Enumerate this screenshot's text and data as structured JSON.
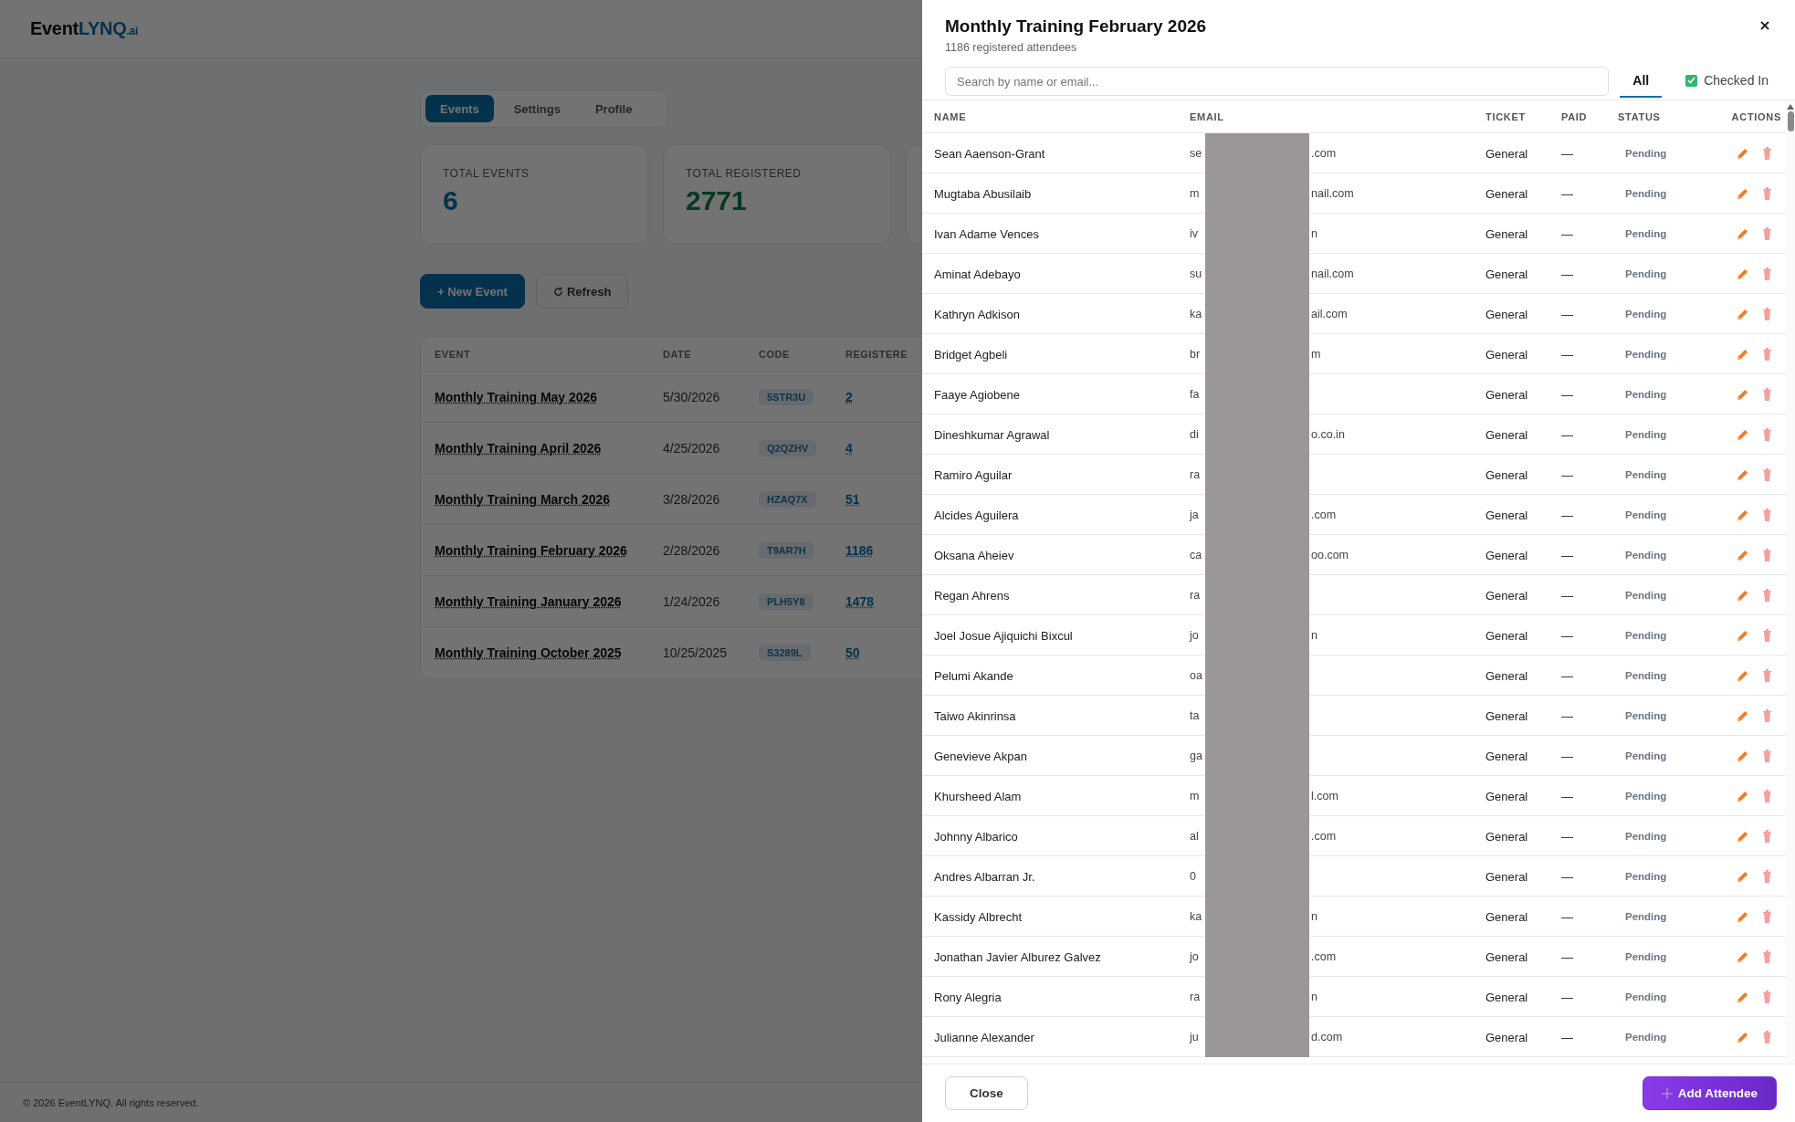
{
  "app": {
    "logo": {
      "main": "Event",
      "accent": "LYNQ",
      "suffix": ".ai"
    },
    "tabs": [
      {
        "label": "Events",
        "selected": true
      },
      {
        "label": "Settings",
        "selected": false
      },
      {
        "label": "Profile",
        "selected": false
      }
    ],
    "stats": [
      {
        "kind": "events",
        "label": "TOTAL EVENTS",
        "value": "6"
      },
      {
        "kind": "registered",
        "label": "TOTAL REGISTERED",
        "value": "2771"
      }
    ],
    "actions": [
      {
        "kind": "primary",
        "label": "+ New Event"
      },
      {
        "kind": "refresh",
        "label": "Refresh"
      }
    ],
    "events_table": {
      "columns": [
        "EVENT",
        "DATE",
        "CODE",
        "REGISTERE"
      ],
      "rows": [
        {
          "event": "Monthly Training May 2026",
          "date": "5/30/2026",
          "code": "5STR3U",
          "registered": "2"
        },
        {
          "event": "Monthly Training April 2026",
          "date": "4/25/2026",
          "code": "Q2QZHV",
          "registered": "4"
        },
        {
          "event": "Monthly Training March 2026",
          "date": "3/28/2026",
          "code": "HZAQ7X",
          "registered": "51"
        },
        {
          "event": "Monthly Training February 2026",
          "date": "2/28/2026",
          "code": "T9AR7H",
          "registered": "1186"
        },
        {
          "event": "Monthly Training January 2026",
          "date": "1/24/2026",
          "code": "PLH5Y8",
          "registered": "1478"
        },
        {
          "event": "Monthly Training October 2025",
          "date": "10/25/2025",
          "code": "S3289L",
          "registered": "50"
        }
      ]
    },
    "footer": "© 2026 EventLYNQ. All rights reserved."
  },
  "modal": {
    "title": "Monthly Training February 2026",
    "subtitle": "1186 registered attendees",
    "search": {
      "placeholder": "Search by name or email..."
    },
    "filters": [
      {
        "label": "All",
        "selected": true
      },
      {
        "label": "Checked In",
        "selected": false,
        "checked": true
      }
    ],
    "columns": [
      "NAME",
      "EMAIL",
      "TICKET",
      "PAID",
      "STATUS",
      "ACTIONS"
    ],
    "rows": [
      {
        "name": "Sean Aaenson-Grant",
        "email_start": "se",
        "email_end": ".com",
        "ticket": "General",
        "paid": "—",
        "status": "Pending"
      },
      {
        "name": "Mugtaba Abusilaib",
        "email_start": "m",
        "email_end": "nail.com",
        "ticket": "General",
        "paid": "—",
        "status": "Pending"
      },
      {
        "name": "Ivan Adame Vences",
        "email_start": "iv",
        "email_end": "n",
        "ticket": "General",
        "paid": "—",
        "status": "Pending"
      },
      {
        "name": "Aminat Adebayo",
        "email_start": "su",
        "email_end": "nail.com",
        "ticket": "General",
        "paid": "—",
        "status": "Pending"
      },
      {
        "name": "Kathryn Adkison",
        "email_start": "ka",
        "email_end": "ail.com",
        "ticket": "General",
        "paid": "—",
        "status": "Pending"
      },
      {
        "name": "Bridget Agbeli",
        "email_start": "br",
        "email_end": "m",
        "ticket": "General",
        "paid": "—",
        "status": "Pending"
      },
      {
        "name": "Faaye Agiobene",
        "email_start": "fa",
        "ticket": "General",
        "paid": "—",
        "status": "Pending"
      },
      {
        "name": "Dineshkumar Agrawal",
        "email_start": "di",
        "email_end": "o.co.in",
        "ticket": "General",
        "paid": "—",
        "status": "Pending"
      },
      {
        "name": "Ramiro Aguilar",
        "email_start": "ra",
        "ticket": "General",
        "paid": "—",
        "status": "Pending"
      },
      {
        "name": "Alcides Aguilera",
        "email_start": "ja",
        "email_end": ".com",
        "ticket": "General",
        "paid": "—",
        "status": "Pending"
      },
      {
        "name": "Oksana Aheiev",
        "email_start": "ca",
        "email_end": "oo.com",
        "ticket": "General",
        "paid": "—",
        "status": "Pending"
      },
      {
        "name": "Regan Ahrens",
        "email_start": "ra",
        "ticket": "General",
        "paid": "—",
        "status": "Pending"
      },
      {
        "name": "Joel Josue Ajiquichi Bixcul",
        "email_start": "jo",
        "email_end": "n",
        "ticket": "General",
        "paid": "—",
        "status": "Pending"
      },
      {
        "name": "Pelumi Akande",
        "email_start": "oa",
        "ticket": "General",
        "paid": "—",
        "status": "Pending"
      },
      {
        "name": "Taiwo Akinrinsa",
        "email_start": "ta",
        "ticket": "General",
        "paid": "—",
        "status": "Pending"
      },
      {
        "name": "Genevieve Akpan",
        "email_start": "ga",
        "ticket": "General",
        "paid": "—",
        "status": "Pending"
      },
      {
        "name": "Khursheed Alam",
        "email_start": "m",
        "email_end": "l.com",
        "ticket": "General",
        "paid": "—",
        "status": "Pending"
      },
      {
        "name": "Johnny Albarico",
        "email_start": "al",
        "email_end": ".com",
        "ticket": "General",
        "paid": "—",
        "status": "Pending"
      },
      {
        "name": "Andres Albarran Jr.",
        "email_start": "0",
        "ticket": "General",
        "paid": "—",
        "status": "Pending"
      },
      {
        "name": "Kassidy Albrecht",
        "email_start": "ka",
        "email_end": "n",
        "ticket": "General",
        "paid": "—",
        "status": "Pending"
      },
      {
        "name": "Jonathan Javier Alburez Galvez",
        "email_start": "jo",
        "email_end": ".com",
        "ticket": "General",
        "paid": "—",
        "status": "Pending"
      },
      {
        "name": "Rony Alegria",
        "email_start": "ra",
        "email_end": "n",
        "ticket": "General",
        "paid": "—",
        "status": "Pending"
      },
      {
        "name": "Julianne Alexander",
        "email_start": "ju",
        "email_end": "d.com",
        "ticket": "General",
        "paid": "—",
        "status": "Pending"
      }
    ],
    "buttons": [
      {
        "kind": "secondary",
        "label": "Close"
      },
      {
        "kind": "primary",
        "label": "Add Attendee"
      }
    ]
  }
}
